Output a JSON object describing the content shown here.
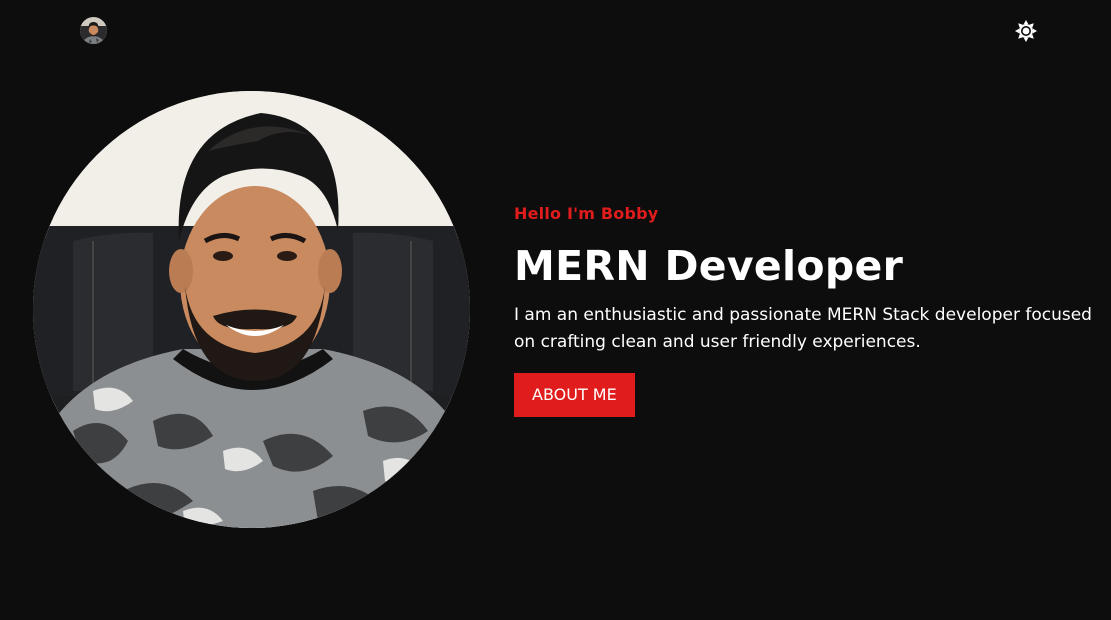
{
  "header": {
    "avatar_icon": "profile-avatar",
    "theme_icon": "sun-icon"
  },
  "hero": {
    "greeting": "Hello I'm Bobby",
    "title": "MERN Developer",
    "description": "I am an enthusiastic and passionate MERN Stack developer focused on crafting clean and user friendly experiences.",
    "button_label": "ABOUT ME",
    "photo": "profile-photo"
  },
  "colors": {
    "background": "#0d0d0e",
    "accent": "#e01c1c",
    "text": "#ffffff"
  }
}
